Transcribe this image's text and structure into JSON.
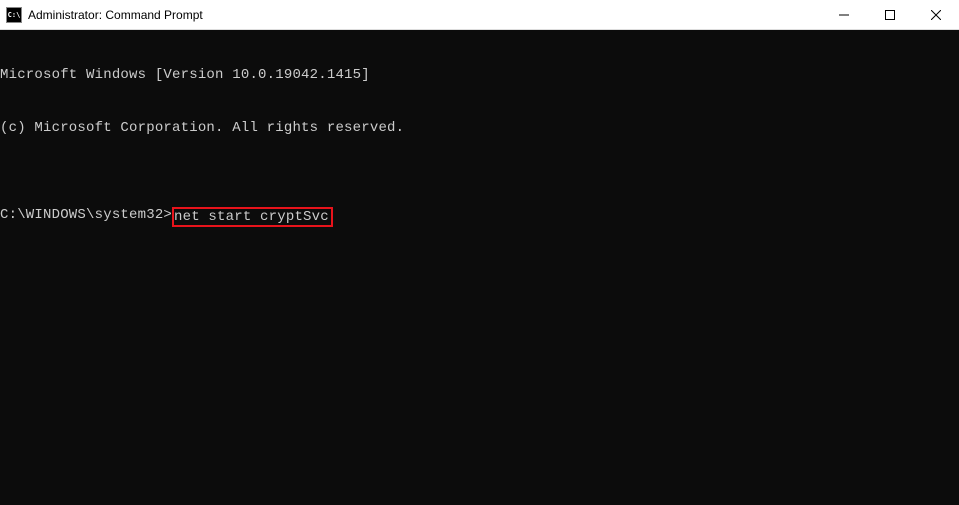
{
  "titlebar": {
    "icon_label": "C:\\",
    "title": "Administrator: Command Prompt"
  },
  "terminal": {
    "line1": "Microsoft Windows [Version 10.0.19042.1415]",
    "line2": "(c) Microsoft Corporation. All rights reserved.",
    "blank": "",
    "prompt": "C:\\WINDOWS\\system32>",
    "command": "net start cryptSvc"
  }
}
